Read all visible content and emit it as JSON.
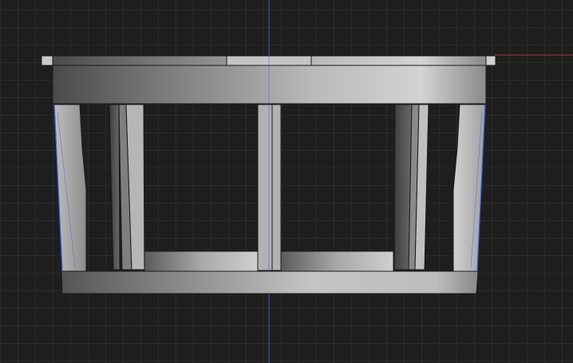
{
  "viewport": {
    "background": "#1e1e1e",
    "grid_color": "#2b2b2b",
    "axis_y_color": "#3b5bd6",
    "axis_x_color": "#b03030"
  },
  "model": {
    "object": "cylindrical-cage-part",
    "body_color": "#8e8e8e",
    "edge_color": "#1a1a1a",
    "selection_edge_color": "#3f5fe0"
  }
}
